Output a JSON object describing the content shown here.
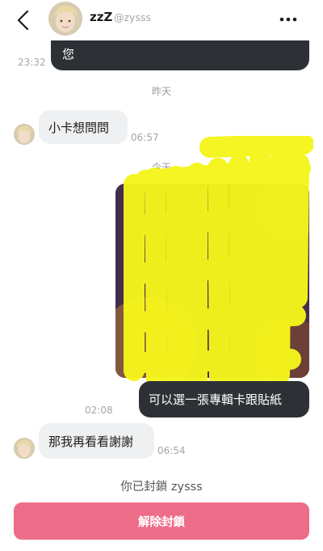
{
  "header": {
    "name": "zzZ",
    "handle": "@zysss",
    "back_icon": "chevron-left-icon",
    "more_icon": "more-horizontal-icon"
  },
  "messages": {
    "m1": {
      "text": "您",
      "time": "23:32",
      "side": "right"
    },
    "sep1": "昨天",
    "m2": {
      "text": "小卡想問問",
      "time": "06:57",
      "side": "left"
    },
    "sep2": "今天",
    "m3_image": {
      "description_icon": "image-attachment",
      "censored": true
    },
    "m3": {
      "text": "可以選一張專輯卡跟貼紙",
      "time": "02:08",
      "side": "right"
    },
    "m4": {
      "text": "那我再看看謝謝",
      "time": "06:54",
      "side": "left"
    }
  },
  "footer": {
    "blocked_note": "你已封鎖 zysss",
    "unblock_label": "解除封鎖"
  },
  "colors": {
    "accent": "#ed6d88",
    "dark_bubble": "#2d3136",
    "light_bubble": "#eff0f1",
    "highlighter": "#f5f51c"
  }
}
